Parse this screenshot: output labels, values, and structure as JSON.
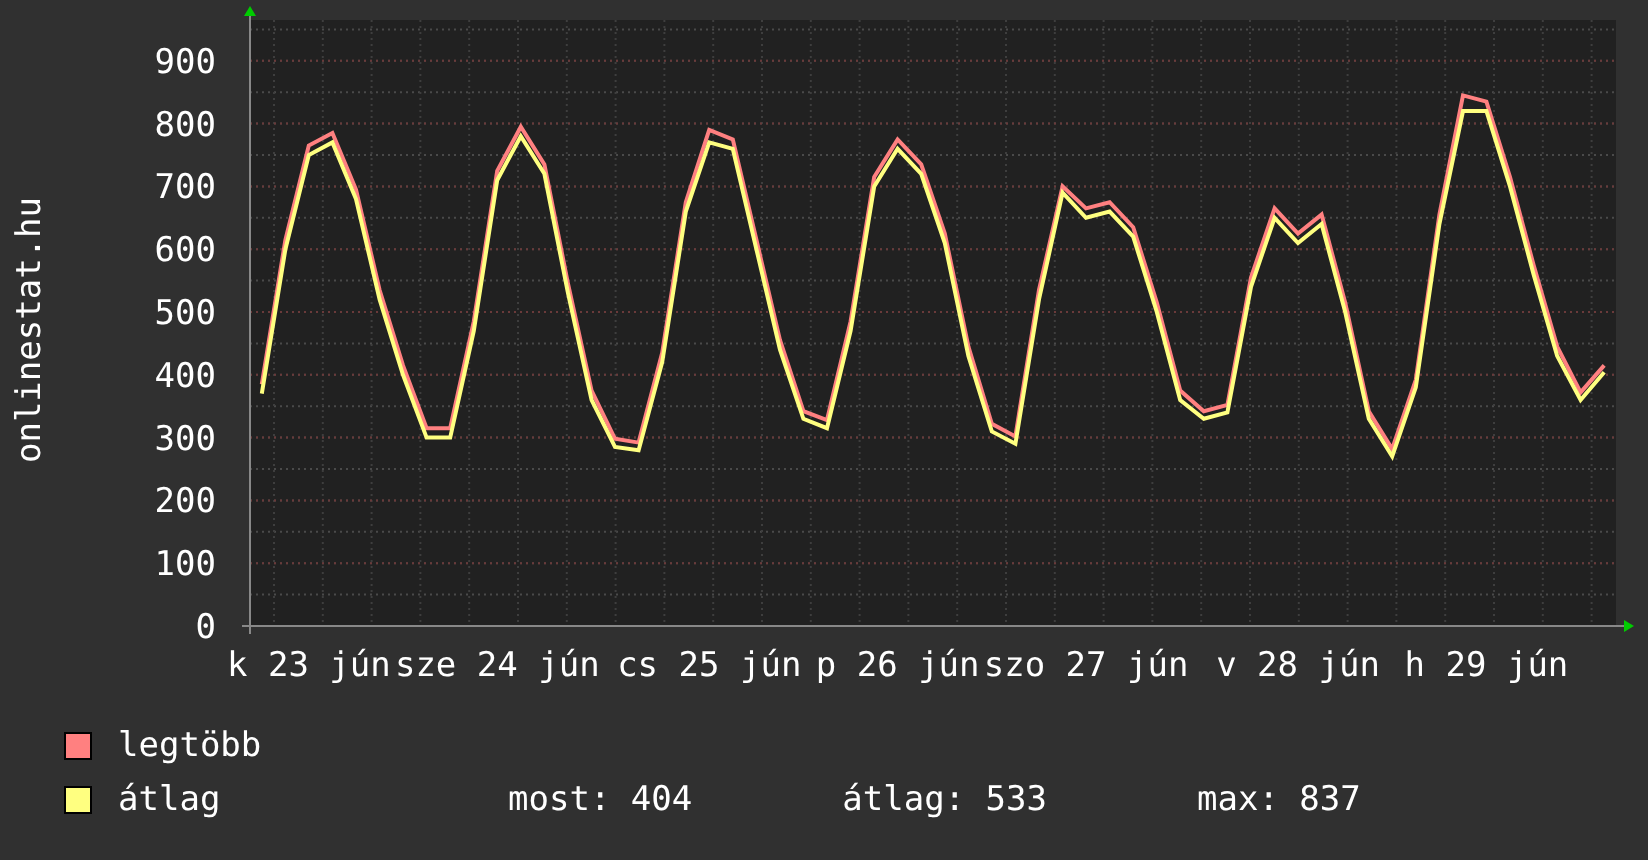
{
  "chart_data": {
    "type": "line",
    "ylabel": "onlinestat.hu",
    "categories": [
      null,
      null,
      "k 23 jún",
      null,
      null,
      null,
      null,
      null,
      null,
      null,
      "sze 24 jún",
      null,
      null,
      null,
      null,
      null,
      null,
      null,
      null,
      "cs 25 jún",
      null,
      null,
      null,
      null,
      null,
      null,
      null,
      "p 26 jún",
      null,
      null,
      null,
      null,
      null,
      null,
      null,
      "szo 27 jún",
      null,
      null,
      null,
      null,
      null,
      null,
      null,
      null,
      "v 28 jún",
      null,
      null,
      null,
      null,
      null,
      null,
      null,
      "h 29 jún",
      null,
      null,
      null,
      null,
      null
    ],
    "ylim": [
      0,
      965
    ],
    "grid": true,
    "yticks": [
      0,
      100,
      200,
      300,
      400,
      500,
      600,
      700,
      800,
      900
    ],
    "series": [
      {
        "name": "legtöbb",
        "color": "#ff8080",
        "values": [
          385,
          615,
          765,
          785,
          695,
          535,
          415,
          315,
          315,
          485,
          725,
          795,
          735,
          545,
          375,
          298,
          292,
          435,
          675,
          790,
          775,
          615,
          455,
          342,
          328,
          485,
          715,
          775,
          735,
          625,
          445,
          322,
          302,
          535,
          700,
          665,
          675,
          635,
          515,
          375,
          342,
          352,
          555,
          665,
          625,
          655,
          515,
          342,
          282,
          392,
          655,
          845,
          835,
          715,
          575,
          445,
          372,
          415
        ]
      },
      {
        "name": "átlag",
        "color": "#ffff80",
        "values": [
          370,
          600,
          750,
          770,
          680,
          520,
          400,
          300,
          300,
          470,
          710,
          780,
          720,
          530,
          360,
          285,
          280,
          420,
          660,
          770,
          760,
          600,
          440,
          330,
          315,
          470,
          700,
          760,
          720,
          610,
          430,
          310,
          290,
          520,
          690,
          650,
          660,
          620,
          500,
          360,
          330,
          340,
          540,
          650,
          610,
          640,
          500,
          330,
          270,
          380,
          640,
          820,
          820,
          700,
          560,
          430,
          360,
          404
        ]
      }
    ]
  },
  "legend": {
    "stats": [
      "most: 404",
      "átlag: 533",
      "max: 837"
    ]
  }
}
